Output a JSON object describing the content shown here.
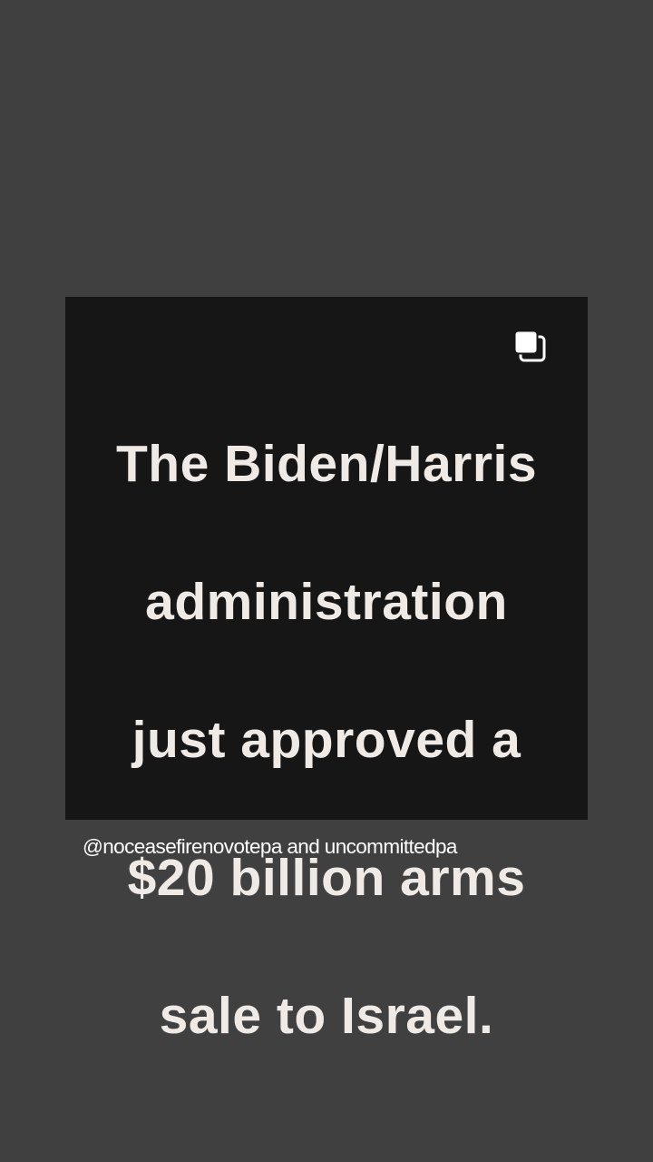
{
  "story": {
    "background_color": "#404040"
  },
  "post": {
    "background_color": "#161616",
    "text_color": "#efeae6",
    "lines": [
      "The Biden/Harris",
      "administration",
      "just approved a",
      "$20 billion arms",
      "sale to Israel."
    ],
    "corner_icon": "multiple-images-icon"
  },
  "caption": {
    "text": "@noceasefirenovotepa and uncommittedpa"
  }
}
